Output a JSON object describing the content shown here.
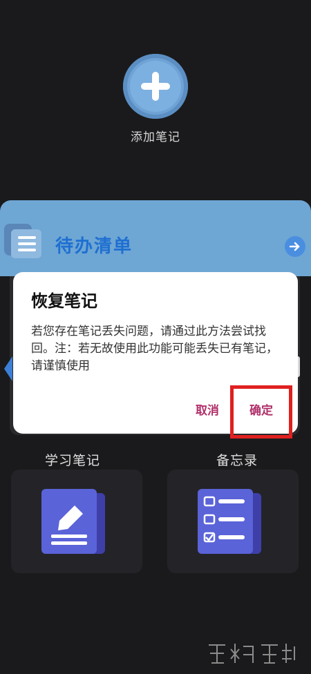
{
  "add_note": {
    "label": "添加笔记"
  },
  "todo": {
    "title": "待办清单"
  },
  "dialog": {
    "title": "恢复笔记",
    "message": "若您存在笔记丢失问题，请通过此方法尝试找回。注：若无故使用此功能可能丢失已有笔记，请谨慎使用",
    "cancel_label": "取消",
    "confirm_label": "确定"
  },
  "cards": {
    "study": {
      "label": "学习笔记"
    },
    "memo": {
      "label": "备忘录"
    }
  },
  "colors": {
    "accent_blue": "#6ea6d4",
    "action_text": "#b0306a",
    "highlight_red": "#e02020"
  }
}
